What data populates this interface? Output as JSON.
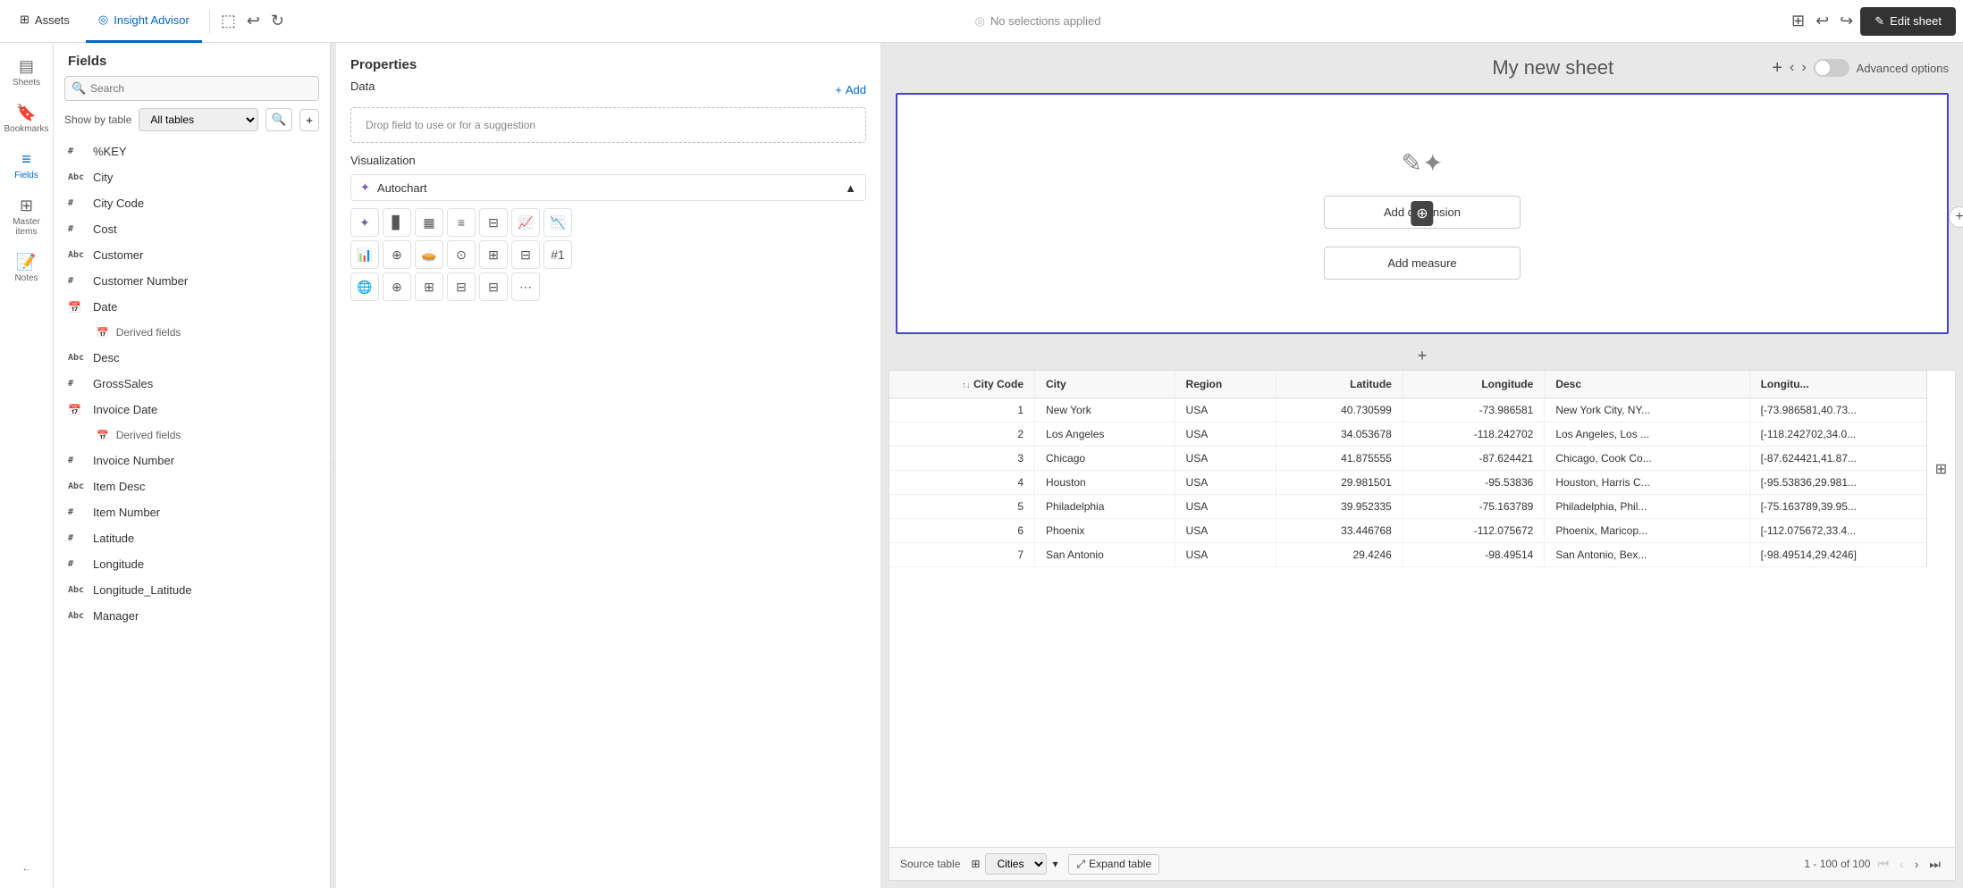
{
  "topbar": {
    "assets_tab": "Assets",
    "insight_advisor_tab": "Insight Advisor",
    "no_selections": "No selections applied",
    "edit_sheet": "Edit sheet"
  },
  "sidebar": {
    "items": [
      {
        "id": "sheets",
        "label": "Sheets",
        "icon": "▤"
      },
      {
        "id": "bookmarks",
        "label": "Bookmarks",
        "icon": "🔖"
      },
      {
        "id": "fields",
        "label": "Fields",
        "icon": "≡"
      },
      {
        "id": "master-items",
        "label": "Master items",
        "icon": "⊞"
      },
      {
        "id": "notes",
        "label": "Notes",
        "icon": "📝"
      }
    ],
    "back_icon": "←"
  },
  "fields_panel": {
    "title": "Fields",
    "search_placeholder": "Search",
    "show_by_table_label": "Show by table",
    "all_tables_option": "All tables",
    "fields": [
      {
        "type": "#",
        "name": "%KEY"
      },
      {
        "type": "Abc",
        "name": "City"
      },
      {
        "type": "#",
        "name": "City Code"
      },
      {
        "type": "#",
        "name": "Cost"
      },
      {
        "type": "Abc",
        "name": "Customer"
      },
      {
        "type": "#",
        "name": "Customer Number"
      },
      {
        "type": "📅",
        "name": "Date",
        "has_derived": true
      },
      {
        "type": "sub",
        "name": "Derived fields"
      },
      {
        "type": "Abc",
        "name": "Desc"
      },
      {
        "type": "#",
        "name": "GrossSales"
      },
      {
        "type": "📅",
        "name": "Invoice Date",
        "has_derived": true
      },
      {
        "type": "sub",
        "name": "Derived fields"
      },
      {
        "type": "#",
        "name": "Invoice Number"
      },
      {
        "type": "Abc",
        "name": "Item Desc"
      },
      {
        "type": "#",
        "name": "Item Number"
      },
      {
        "type": "#",
        "name": "Latitude"
      },
      {
        "type": "#",
        "name": "Longitude"
      },
      {
        "type": "Abc",
        "name": "Longitude_Latitude"
      },
      {
        "type": "Abc",
        "name": "Manager"
      }
    ]
  },
  "properties_panel": {
    "title": "Properties",
    "data_label": "Data",
    "add_label": "Add",
    "drop_hint": "Drop field to use or for a suggestion",
    "visualization_label": "Visualization",
    "autochart_label": "Autochart"
  },
  "sheet": {
    "title": "My new sheet",
    "add_dimension_btn": "Add dimension",
    "add_measure_btn": "Add measure",
    "advanced_options": "Advanced options"
  },
  "table": {
    "columns": [
      {
        "id": "city_code",
        "label": "City Code",
        "numeric": true,
        "sort": true
      },
      {
        "id": "city",
        "label": "City",
        "numeric": false
      },
      {
        "id": "region",
        "label": "Region",
        "numeric": false
      },
      {
        "id": "latitude",
        "label": "Latitude",
        "numeric": true
      },
      {
        "id": "longitude",
        "label": "Longitude",
        "numeric": true
      },
      {
        "id": "desc",
        "label": "Desc",
        "numeric": false
      },
      {
        "id": "longitu_lat",
        "label": "Longitu...",
        "numeric": false
      }
    ],
    "rows": [
      {
        "city_code": "1",
        "city": "New York",
        "region": "USA",
        "latitude": "40.730599",
        "longitude": "-73.986581",
        "desc": "New York City, NY...",
        "longitu_lat": "[-73.986581,40.73..."
      },
      {
        "city_code": "2",
        "city": "Los Angeles",
        "region": "USA",
        "latitude": "34.053678",
        "longitude": "-118.242702",
        "desc": "Los Angeles, Los ...",
        "longitu_lat": "[-118.242702,34.0..."
      },
      {
        "city_code": "3",
        "city": "Chicago",
        "region": "USA",
        "latitude": "41.875555",
        "longitude": "-87.624421",
        "desc": "Chicago, Cook Co...",
        "longitu_lat": "[-87.624421,41.87..."
      },
      {
        "city_code": "4",
        "city": "Houston",
        "region": "USA",
        "latitude": "29.981501",
        "longitude": "-95.53836",
        "desc": "Houston, Harris C...",
        "longitu_lat": "[-95.53836,29.981..."
      },
      {
        "city_code": "5",
        "city": "Philadelphia",
        "region": "USA",
        "latitude": "39.952335",
        "longitude": "-75.163789",
        "desc": "Philadelphia, Phil...",
        "longitu_lat": "[-75.163789,39.95..."
      },
      {
        "city_code": "6",
        "city": "Phoenix",
        "region": "USA",
        "latitude": "33.446768",
        "longitude": "-112.075672",
        "desc": "Phoenix, Maricop...",
        "longitu_lat": "[-112.075672,33.4..."
      },
      {
        "city_code": "7",
        "city": "San Antonio",
        "region": "USA",
        "latitude": "29.4246",
        "longitude": "-98.49514",
        "desc": "San Antonio, Bex...",
        "longitu_lat": "[-98.49514,29.4246]"
      }
    ],
    "source_label": "Source table",
    "source_table": "Cities",
    "expand_btn": "Expand table",
    "pagination_info": "1 - 100 of 100"
  },
  "viz_icons": [
    "✏️",
    "📊",
    "📊",
    "⊟",
    "▦",
    "📈",
    "📉",
    "📊",
    "⊕",
    "🥧",
    "⊙",
    "⊞",
    "⊟",
    "#1",
    "🌐",
    "⊕",
    "⊞",
    "⊟",
    "⊟",
    "⋯"
  ]
}
